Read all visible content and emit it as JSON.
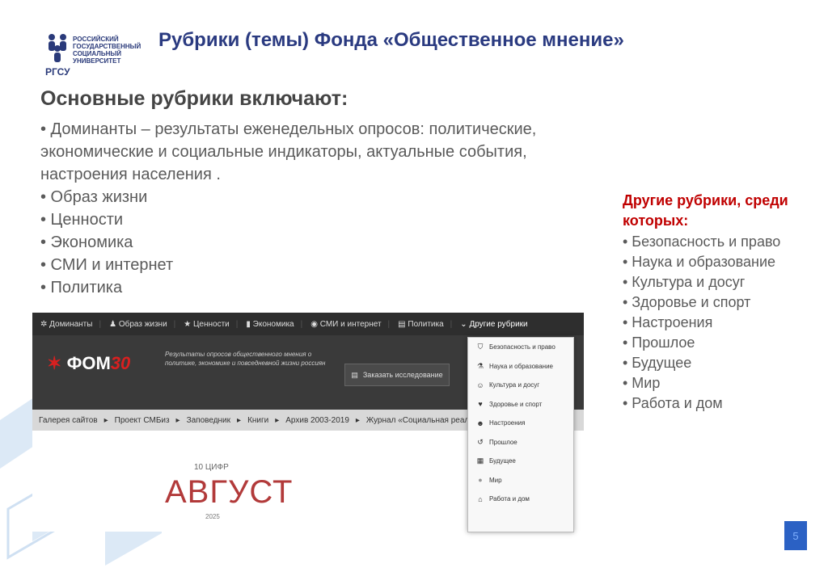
{
  "logo": {
    "lines": [
      "РОССИЙСКИЙ",
      "ГОСУДАРСТВЕННЫЙ",
      "СОЦИАЛЬНЫЙ",
      "УНИВЕРСИТЕТ"
    ],
    "abbr": "РГСУ"
  },
  "slide": {
    "title": "Рубрики (темы) Фонда «Общественное мнение»",
    "heading": "Основные рубрики включают:",
    "main_items": [
      "• Доминанты – результаты еженедельных опросов: политические, экономические и социальные индикаторы, актуальные события, настроения населения  .",
      "• Образ жизни",
      "• Ценности",
      "• Экономика",
      "• СМИ и интернет",
      "• Политика"
    ],
    "right_heading": "Другие рубрики, среди которых:",
    "right_items": [
      "• Безопасность и право",
      "• Наука и образование",
      "• Культура и досуг",
      "• Здоровье и спорт",
      "• Настроения",
      "• Прошлое",
      "• Будущее",
      "• Мир",
      "• Работа и дом"
    ],
    "page_number": "5"
  },
  "screenshot": {
    "nav": [
      "Доминанты",
      "Образ жизни",
      "Ценности",
      "Экономика",
      "СМИ и интернет",
      "Политика",
      "Другие рубрики"
    ],
    "brand": "ФОМ",
    "brand_suffix": "30",
    "banner_desc": "Результаты опросов общественного мнения о политике, экономике и повседневной жизни россиян",
    "order_button": "Заказать исследование",
    "breadcrumbs": [
      "Галерея сайтов",
      "Проект СМБиз",
      "Заповедник",
      "Книги",
      "Архив 2003-2019",
      "Журнал «Социальная реаль"
    ],
    "promo_small": "10 ЦИФР",
    "promo_big": "АВГУСТ",
    "promo_year": "2025",
    "dropdown": [
      {
        "label": "Безопасность и право",
        "icon": "shield-icon"
      },
      {
        "label": "Наука и образование",
        "icon": "flask-icon"
      },
      {
        "label": "Культура и досуг",
        "icon": "masks-icon"
      },
      {
        "label": "Здоровье и спорт",
        "icon": "heart-icon"
      },
      {
        "label": "Настроения",
        "icon": "smile-icon"
      },
      {
        "label": "Прошлое",
        "icon": "history-icon"
      },
      {
        "label": "Будущее",
        "icon": "calendar-icon"
      },
      {
        "label": "Мир",
        "icon": "globe-icon"
      },
      {
        "label": "Работа и дом",
        "icon": "home-icon"
      }
    ]
  },
  "colors": {
    "title": "#2a3a80",
    "accent_red": "#c00000",
    "page_badge": "#2b61c4"
  }
}
